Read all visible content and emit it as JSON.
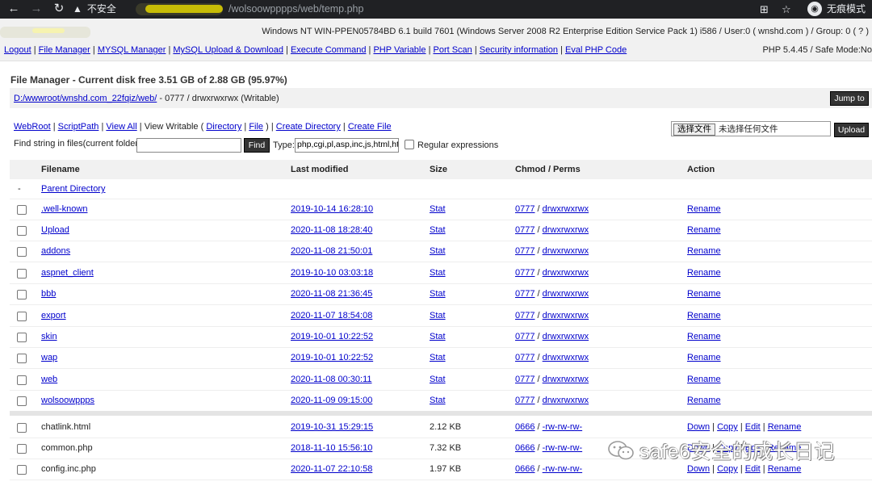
{
  "browser": {
    "security_label": "不安全",
    "url_path": "/wolsoowpppps/web/temp.php",
    "incognito_label": "无痕模式"
  },
  "info": {
    "system": "Windows NT WIN-PPEN05784BD 6.1 build 7601 (Windows Server 2008 R2 Enterprise Edition Service Pack 1) i586 / User:0 ( wnshd.com ) / Group: 0 ( ? )",
    "php": "PHP 5.4.45 / Safe Mode:No"
  },
  "menu": [
    "Logout",
    "File Manager",
    "MYSQL Manager",
    "MySQL Upload & Download",
    "Execute Command",
    "PHP Variable",
    "Port Scan",
    "Security information",
    "Eval PHP Code"
  ],
  "file_manager": {
    "title": "File Manager - Current disk free 3.51 GB of 2.88 GB (95.97%)",
    "path_link": "D:/wwwroot/wnshd.com_22fqiz/web/",
    "path_perms": " - 0777 / drwxrwxrwx (Writable)",
    "jump_label": "Jump to",
    "views": {
      "webroot": "WebRoot",
      "scriptpath": "ScriptPath",
      "view_all": "View All",
      "view_writable": "View Writable (",
      "directory": "Directory",
      "file": "File",
      "close": ")",
      "create_directory": "Create Directory",
      "create_file": "Create File"
    },
    "find_label": "Find string in files(current folder):",
    "find_value": "",
    "find_button": "Find",
    "type_label": "Type:",
    "type_value": "php,cgi,pl,asp,inc,js,html,htm",
    "regex_label": "Regular expressions",
    "choose_file_label": "选择文件",
    "no_file_label": "未选择任何文件",
    "upload_label": "Upload"
  },
  "table": {
    "headers": {
      "filename": "Filename",
      "modified": "Last modified",
      "size": "Size",
      "perms": "Chmod / Perms",
      "action": "Action"
    },
    "parent": {
      "marker": "-",
      "label": "Parent Directory"
    },
    "dirs": [
      {
        "name": ".well-known",
        "modified": "2019-10-14 16:28:10",
        "size": "Stat",
        "chmod": "0777",
        "perms": "drwxrwxrwx",
        "action": "Rename"
      },
      {
        "name": "Upload",
        "modified": "2020-11-08 18:28:40",
        "size": "Stat",
        "chmod": "0777",
        "perms": "drwxrwxrwx",
        "action": "Rename"
      },
      {
        "name": "addons",
        "modified": "2020-11-08 21:50:01",
        "size": "Stat",
        "chmod": "0777",
        "perms": "drwxrwxrwx",
        "action": "Rename"
      },
      {
        "name": "aspnet_client",
        "modified": "2019-10-10 03:03:18",
        "size": "Stat",
        "chmod": "0777",
        "perms": "drwxrwxrwx",
        "action": "Rename"
      },
      {
        "name": "bbb",
        "modified": "2020-11-08 21:36:45",
        "size": "Stat",
        "chmod": "0777",
        "perms": "drwxrwxrwx",
        "action": "Rename"
      },
      {
        "name": "export",
        "modified": "2020-11-07 18:54:08",
        "size": "Stat",
        "chmod": "0777",
        "perms": "drwxrwxrwx",
        "action": "Rename"
      },
      {
        "name": "skin",
        "modified": "2019-10-01 10:22:52",
        "size": "Stat",
        "chmod": "0777",
        "perms": "drwxrwxrwx",
        "action": "Rename"
      },
      {
        "name": "wap",
        "modified": "2019-10-01 10:22:52",
        "size": "Stat",
        "chmod": "0777",
        "perms": "drwxrwxrwx",
        "action": "Rename"
      },
      {
        "name": "web",
        "modified": "2020-11-08 00:30:11",
        "size": "Stat",
        "chmod": "0777",
        "perms": "drwxrwxrwx",
        "action": "Rename"
      },
      {
        "name": "wolsoowppps",
        "modified": "2020-11-09 09:15:00",
        "size": "Stat",
        "chmod": "0777",
        "perms": "drwxrwxrwx",
        "action": "Rename"
      }
    ],
    "files": [
      {
        "name": "chatlink.html",
        "modified": "2019-10-31 15:29:15",
        "size": "2.12 KB",
        "chmod": "0666",
        "perms": "-rw-rw-rw-"
      },
      {
        "name": "common.php",
        "modified": "2018-11-10 15:56:10",
        "size": "7.32 KB",
        "chmod": "0666",
        "perms": "-rw-rw-rw-"
      },
      {
        "name": "config.inc.php",
        "modified": "2020-11-07 22:10:58",
        "size": "1.97 KB",
        "chmod": "0666",
        "perms": "-rw-rw-rw-"
      }
    ],
    "file_actions": {
      "down": "Down",
      "copy": "Copy",
      "edit": "Edit",
      "rename": "Rename"
    }
  },
  "watermark": {
    "text": "safe6安全的成长日记"
  }
}
